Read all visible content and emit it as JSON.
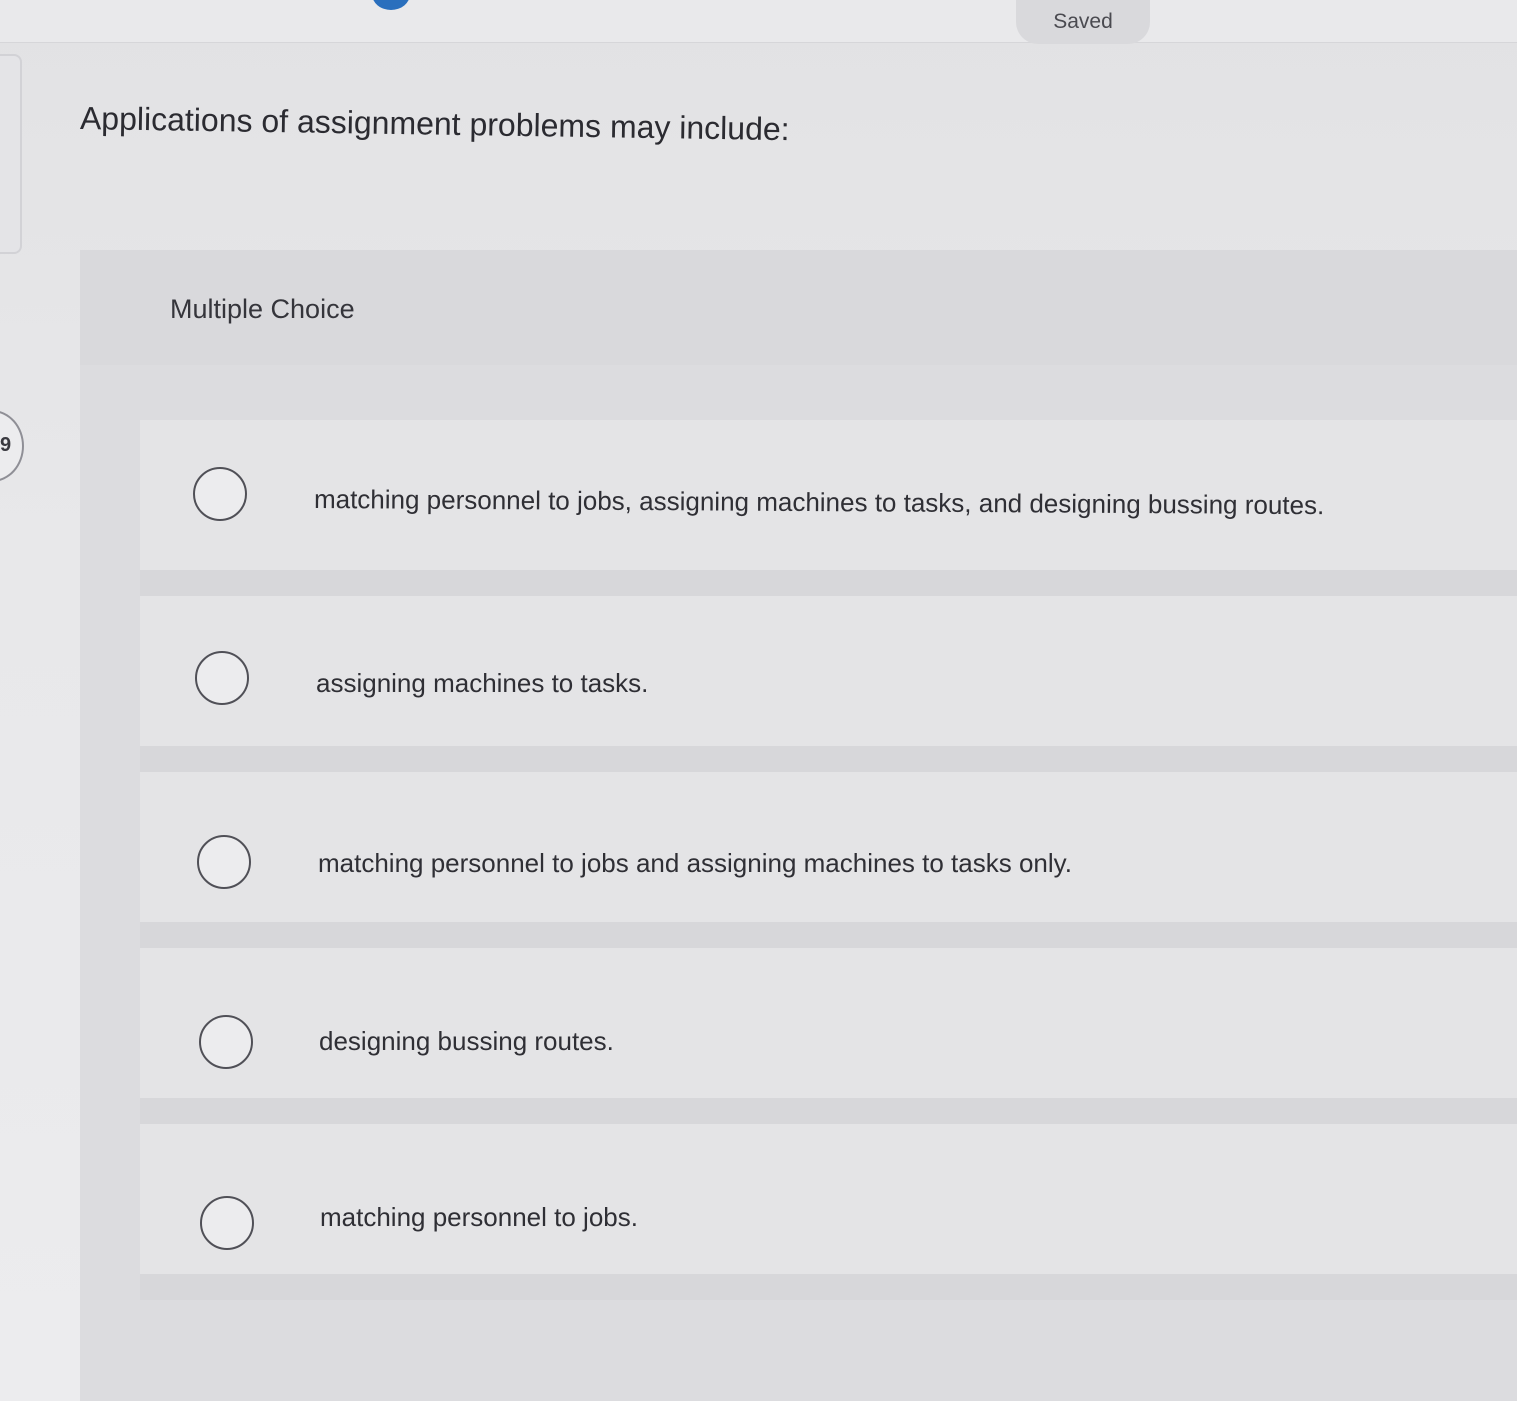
{
  "header": {
    "status": "Saved"
  },
  "sidebar": {
    "question_number": "9"
  },
  "question": {
    "prompt": "Applications of assignment problems may include:",
    "type_label": "Multiple Choice",
    "options": [
      {
        "label": "matching personnel to jobs, assigning machines to tasks, and designing bussing routes.",
        "selected": false
      },
      {
        "label": "assigning machines to tasks.",
        "selected": false
      },
      {
        "label": "matching personnel to jobs and assigning machines to tasks only.",
        "selected": false
      },
      {
        "label": "designing bussing routes.",
        "selected": false
      },
      {
        "label": "matching personnel to jobs.",
        "selected": false
      }
    ]
  },
  "colors": {
    "accent": "#2a6fbd",
    "panel": "#dcdcdf",
    "text": "#2e2e33"
  }
}
